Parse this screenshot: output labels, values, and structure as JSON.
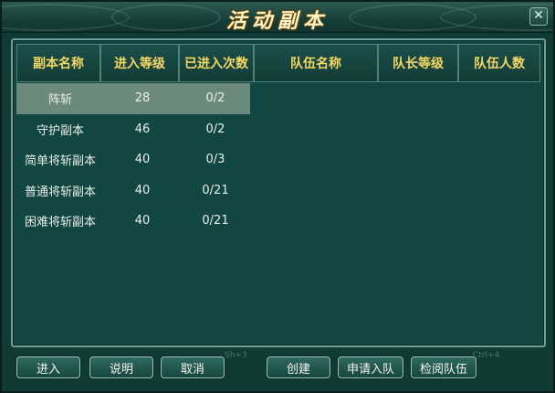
{
  "window": {
    "title": "活动副本"
  },
  "table": {
    "headers": [
      "副本名称",
      "进入等级",
      "已进入次数",
      "队伍名称",
      "队长等级",
      "队伍人数"
    ],
    "rows": [
      {
        "name": "阵斩",
        "level": "28",
        "count": "0/2",
        "selected": true
      },
      {
        "name": "守护副本",
        "level": "46",
        "count": "0/2",
        "selected": false
      },
      {
        "name": "简单将斩副本",
        "level": "40",
        "count": "0/3",
        "selected": false
      },
      {
        "name": "普通将斩副本",
        "level": "40",
        "count": "0/21",
        "selected": false
      },
      {
        "name": "困难将斩副本",
        "level": "40",
        "count": "0/21",
        "selected": false
      }
    ]
  },
  "buttons": {
    "enter": "进入",
    "info": "说明",
    "cancel": "取消",
    "create": "创建",
    "apply": "申请入队",
    "view": "检阅队伍"
  },
  "hotkeys": {
    "left": "Sh+3",
    "right": "Ctrl+4"
  },
  "colors": {
    "header_text": "#f3d764",
    "selected_row": "#6c8a7c",
    "panel_bg": "#114642"
  }
}
